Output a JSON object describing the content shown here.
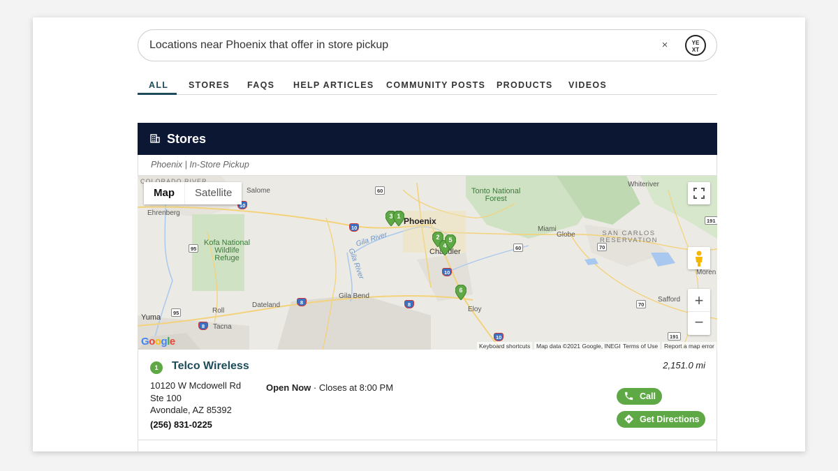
{
  "search": {
    "query": "Locations near Phoenix that offer in store pickup",
    "clear_label": "×",
    "logo_top": "YE",
    "logo_bottom": "XT"
  },
  "tabs": [
    {
      "label": "ALL",
      "active": true
    },
    {
      "label": "STORES"
    },
    {
      "label": "FAQS"
    },
    {
      "label": "HELP ARTICLES"
    },
    {
      "label": "COMMUNITY POSTS"
    },
    {
      "label": "PRODUCTS"
    },
    {
      "label": "VIDEOS"
    }
  ],
  "section": {
    "title": "Stores",
    "filters": "Phoenix | In-Store Pickup"
  },
  "map": {
    "type_buttons": [
      "Map",
      "Satellite"
    ],
    "labels": {
      "colorado_river": "COLORADO RIVER",
      "salome": "Salome",
      "ehrenberg": "Ehrenberg",
      "kofa": "Kofa National\nWildlife\nRefuge",
      "tonto": "Tonto National\nForest",
      "phoenix": "Phoenix",
      "chandler": "Chandler",
      "gila_river": "Gila River",
      "gila_river_2": "Gila River",
      "whiteriver": "Whiteriver",
      "miami": "Miami",
      "globe": "Globe",
      "san_carlos": "SAN CARLOS\nRESERVATION",
      "moren": "Moren",
      "safford": "Safford",
      "eloy": "Eloy",
      "gila_bend": "Gila Bend",
      "dateland": "Dateland",
      "roll": "Roll",
      "tacna": "Tacna",
      "yuma": "Yuma"
    },
    "shields": [
      "60",
      "10",
      "10",
      "95",
      "60",
      "70",
      "191",
      "95",
      "8",
      "8",
      "8",
      "10",
      "70",
      "191",
      "10"
    ],
    "markers": [
      "3",
      "1",
      "2",
      "4",
      "5",
      "6"
    ],
    "attribution": {
      "google": "Google",
      "keyboard": "Keyboard shortcuts",
      "data": "Map data ©2021 Google, INEGI",
      "terms": "Terms of Use",
      "report": "Report a map error"
    },
    "zoom_in": "+",
    "zoom_out": "−"
  },
  "results": [
    {
      "number": "1",
      "name": "Telco Wireless",
      "distance": "2,151.0 mi",
      "address_line1": "10120 W Mcdowell Rd",
      "address_line2": "Ste 100",
      "address_line3": "Avondale, AZ 85392",
      "phone": "(256) 831-0225",
      "status": "Open Now",
      "hours": " · Closes at 8:00 PM",
      "call_label": "Call",
      "directions_label": "Get Directions"
    }
  ],
  "colors": {
    "accent": "#1e4b5a",
    "header_bg": "#0b1733",
    "marker_green": "#5ea845"
  }
}
